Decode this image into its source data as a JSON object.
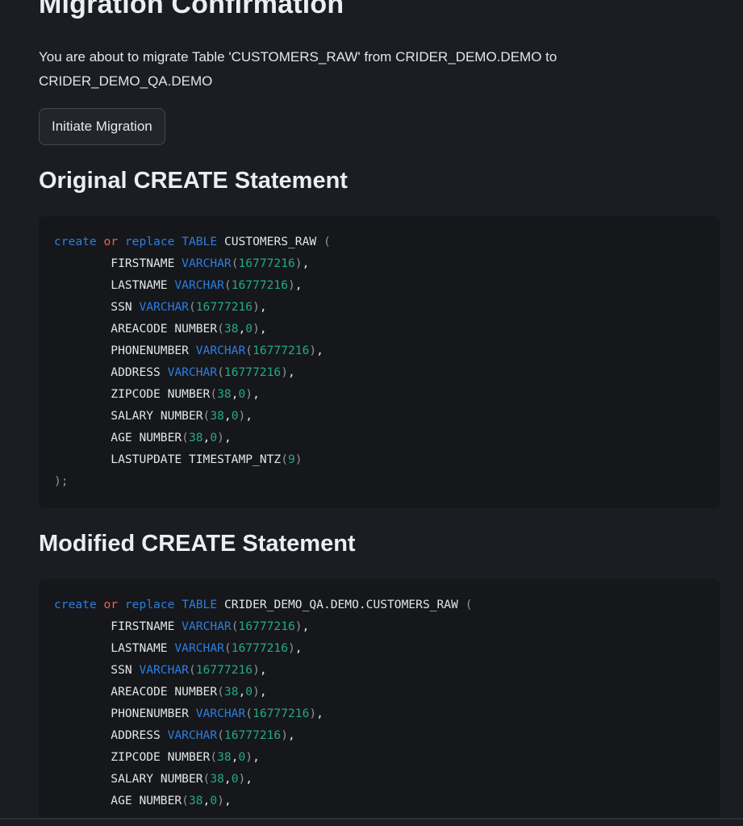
{
  "page": {
    "title": "Migration Confirmation",
    "description_line1": "You are about to migrate Table 'CUSTOMERS_RAW' from CRIDER_DEMO.DEMO to",
    "description_line2": "CRIDER_DEMO_QA.DEMO",
    "initiate_button": "Initiate Migration"
  },
  "original": {
    "heading": "Original CREATE Statement",
    "header": {
      "create": "create",
      "or": "or",
      "replace": "replace",
      "table": "TABLE",
      "name": "CUSTOMERS_RAW"
    },
    "columns": [
      {
        "name": "FIRSTNAME",
        "type": "VARCHAR",
        "args": [
          "16777216"
        ],
        "kw": true
      },
      {
        "name": "LASTNAME",
        "type": "VARCHAR",
        "args": [
          "16777216"
        ],
        "kw": true
      },
      {
        "name": "SSN",
        "type": "VARCHAR",
        "args": [
          "16777216"
        ],
        "kw": true
      },
      {
        "name": "AREACODE",
        "type": "NUMBER",
        "args": [
          "38",
          "0"
        ],
        "kw": false
      },
      {
        "name": "PHONENUMBER",
        "type": "VARCHAR",
        "args": [
          "16777216"
        ],
        "kw": true
      },
      {
        "name": "ADDRESS",
        "type": "VARCHAR",
        "args": [
          "16777216"
        ],
        "kw": true
      },
      {
        "name": "ZIPCODE",
        "type": "NUMBER",
        "args": [
          "38",
          "0"
        ],
        "kw": false
      },
      {
        "name": "SALARY",
        "type": "NUMBER",
        "args": [
          "38",
          "0"
        ],
        "kw": false
      },
      {
        "name": "AGE",
        "type": "NUMBER",
        "args": [
          "38",
          "0"
        ],
        "kw": false
      },
      {
        "name": "LASTUPDATE",
        "type": "TIMESTAMP_NTZ",
        "args": [
          "9"
        ],
        "kw": false
      }
    ],
    "closing": ");"
  },
  "modified": {
    "heading": "Modified CREATE Statement",
    "header": {
      "create": "create",
      "or": "or",
      "replace": "replace",
      "table": "TABLE",
      "name": "CRIDER_DEMO_QA.DEMO.CUSTOMERS_RAW"
    },
    "columns": [
      {
        "name": "FIRSTNAME",
        "type": "VARCHAR",
        "args": [
          "16777216"
        ],
        "kw": true
      },
      {
        "name": "LASTNAME",
        "type": "VARCHAR",
        "args": [
          "16777216"
        ],
        "kw": true
      },
      {
        "name": "SSN",
        "type": "VARCHAR",
        "args": [
          "16777216"
        ],
        "kw": true
      },
      {
        "name": "AREACODE",
        "type": "NUMBER",
        "args": [
          "38",
          "0"
        ],
        "kw": false
      },
      {
        "name": "PHONENUMBER",
        "type": "VARCHAR",
        "args": [
          "16777216"
        ],
        "kw": true
      },
      {
        "name": "ADDRESS",
        "type": "VARCHAR",
        "args": [
          "16777216"
        ],
        "kw": true
      },
      {
        "name": "ZIPCODE",
        "type": "NUMBER",
        "args": [
          "38",
          "0"
        ],
        "kw": false
      },
      {
        "name": "SALARY",
        "type": "NUMBER",
        "args": [
          "38",
          "0"
        ],
        "kw": false
      },
      {
        "name": "AGE",
        "type": "NUMBER",
        "args": [
          "38",
          "0"
        ],
        "kw": false
      }
    ]
  },
  "colors": {
    "background": "#1b1d22",
    "code_background": "#15171b",
    "keyword": "#2e7ee0",
    "operator": "#e8673c",
    "number": "#24a98a"
  }
}
